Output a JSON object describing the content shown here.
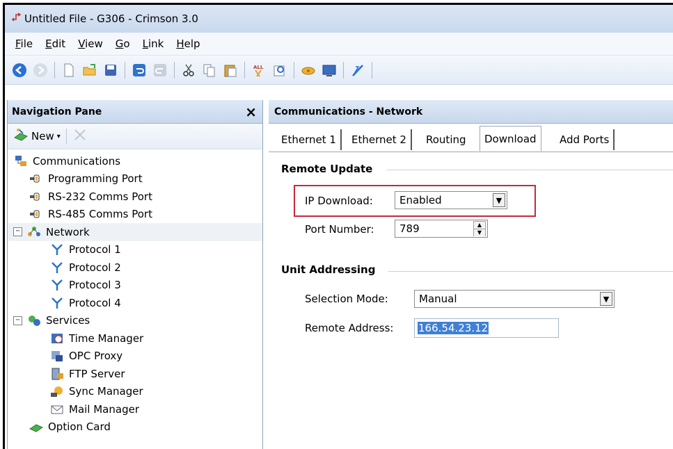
{
  "window": {
    "title": "Untitled File - G306 - Crimson 3.0"
  },
  "menu": [
    {
      "label": "File",
      "key": "F",
      "rest": "ile"
    },
    {
      "label": "Edit",
      "key": "E",
      "rest": "dit"
    },
    {
      "label": "View",
      "key": "V",
      "rest": "iew"
    },
    {
      "label": "Go",
      "key": "G",
      "rest": "o"
    },
    {
      "label": "Link",
      "key": "L",
      "rest": "ink"
    },
    {
      "label": "Help",
      "key": "H",
      "rest": "elp"
    }
  ],
  "toolbar": {
    "icons": [
      "back-icon",
      "forward-icon",
      "new-file-icon",
      "open-folder-icon",
      "save-icon",
      "undo-icon",
      "redo-icon",
      "cut-icon",
      "copy-icon",
      "paste-icon",
      "find-all-icon",
      "find-icon",
      "link-icon",
      "monitor-icon",
      "wand-icon"
    ]
  },
  "nav_pane": {
    "title": "Navigation Pane",
    "close": "×",
    "new_label": "New",
    "tree": [
      {
        "label": "Communications",
        "icon": "communications-icon",
        "level": 0,
        "expander": ""
      },
      {
        "label": "Programming Port",
        "icon": "port-icon",
        "level": 1,
        "expander": ""
      },
      {
        "label": "RS-232 Comms Port",
        "icon": "port-icon",
        "level": 1,
        "expander": ""
      },
      {
        "label": "RS-485 Comms Port",
        "icon": "port-icon",
        "level": 1,
        "expander": ""
      },
      {
        "label": "Network",
        "icon": "network-icon",
        "level": 0,
        "expander": "−"
      },
      {
        "label": "Protocol 1",
        "icon": "protocol-icon",
        "level": 2,
        "expander": ""
      },
      {
        "label": "Protocol 2",
        "icon": "protocol-icon",
        "level": 2,
        "expander": ""
      },
      {
        "label": "Protocol 3",
        "icon": "protocol-icon",
        "level": 2,
        "expander": ""
      },
      {
        "label": "Protocol 4",
        "icon": "protocol-icon",
        "level": 2,
        "expander": ""
      },
      {
        "label": "Services",
        "icon": "services-icon",
        "level": 0,
        "expander": "−"
      },
      {
        "label": "Time Manager",
        "icon": "time-manager-icon",
        "level": 2,
        "expander": ""
      },
      {
        "label": "OPC Proxy",
        "icon": "opc-proxy-icon",
        "level": 2,
        "expander": ""
      },
      {
        "label": "FTP Server",
        "icon": "ftp-server-icon",
        "level": 2,
        "expander": ""
      },
      {
        "label": "Sync Manager",
        "icon": "sync-manager-icon",
        "level": 2,
        "expander": ""
      },
      {
        "label": "Mail Manager",
        "icon": "mail-manager-icon",
        "level": 2,
        "expander": ""
      },
      {
        "label": "Option Card",
        "icon": "option-card-icon",
        "level": 1,
        "expander": ""
      }
    ]
  },
  "content": {
    "title": "Communications - Network",
    "tabs": [
      "Ethernet 1",
      "Ethernet 2",
      "Routing",
      "Download",
      "Add Ports"
    ],
    "active_tab": "Download",
    "remote_update": {
      "title": "Remote Update",
      "ip_download_label": "IP Download:",
      "ip_download_value": "Enabled",
      "port_number_label": "Port Number:",
      "port_number_value": "789"
    },
    "unit_addressing": {
      "title": "Unit Addressing",
      "selection_mode_label": "Selection Mode:",
      "selection_mode_value": "Manual",
      "remote_address_label": "Remote Address:",
      "remote_address_value": "166.54.23.12"
    }
  },
  "colors": {
    "highlight": "#c8283a",
    "header": "#c7d7ec",
    "selection": "#3f80d6"
  }
}
